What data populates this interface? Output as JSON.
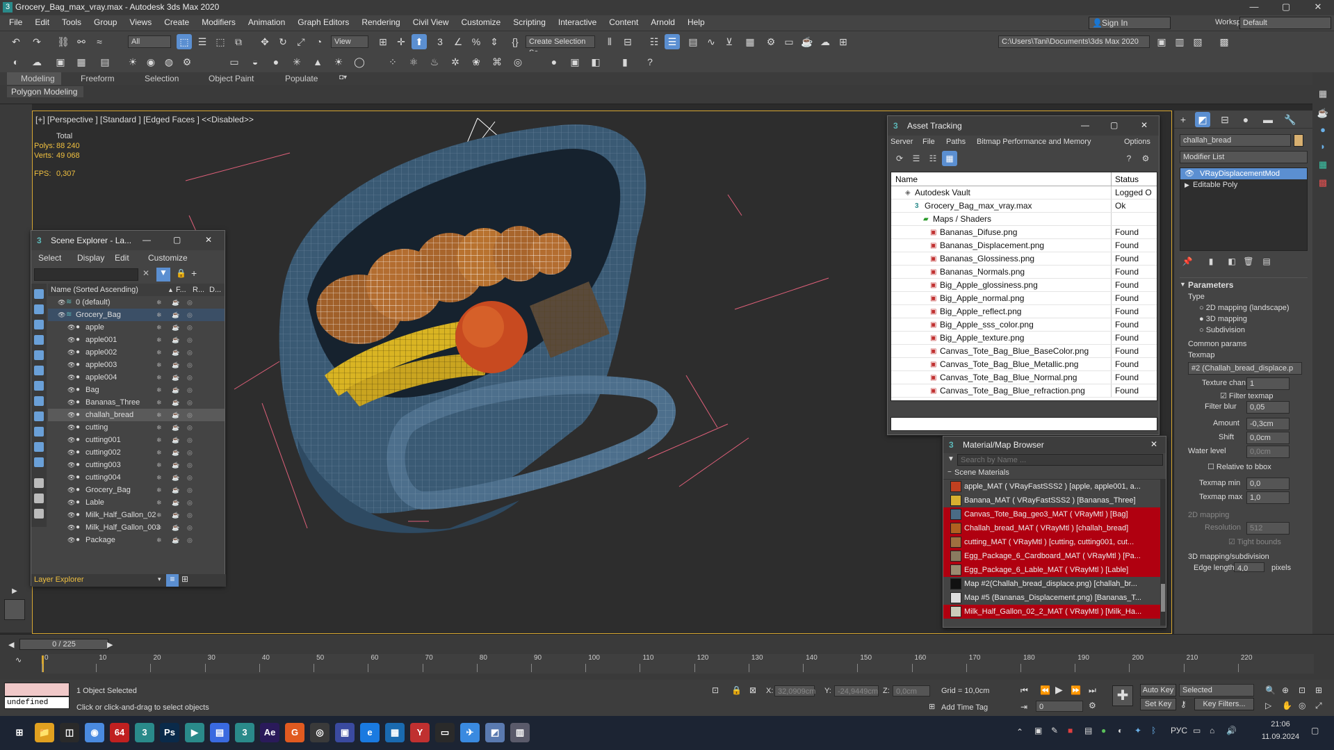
{
  "window": {
    "title": "Grocery_Bag_max_vray.max - Autodesk 3ds Max 2020",
    "app_icon": "3",
    "min": "—",
    "max": "▢",
    "close": "✕"
  },
  "menu": [
    "File",
    "Edit",
    "Tools",
    "Group",
    "Views",
    "Create",
    "Modifiers",
    "Animation",
    "Graph Editors",
    "Rendering",
    "Civil View",
    "Customize",
    "Scripting",
    "Interactive",
    "Content",
    "Arnold",
    "Help"
  ],
  "account": {
    "sign_in": "Sign In",
    "workspaces_label": "Workspaces:",
    "workspace": "Default"
  },
  "toolbar": {
    "filter": "All",
    "ref_coord": "View",
    "selection_set": "Create Selection Se",
    "project_path": "C:\\Users\\Tani\\Documents\\3ds Max 2020"
  },
  "ribbon": {
    "tabs": [
      "Modeling",
      "Freeform",
      "Selection",
      "Object Paint",
      "Populate"
    ],
    "sub": "Polygon Modeling"
  },
  "viewport": {
    "label": "[+] [Perspective ] [Standard ] [Edged Faces ]  <<Disabled>>",
    "stats_total": "Total",
    "polys_label": "Polys:",
    "polys": "88 240",
    "verts_label": "Verts:",
    "verts": "49 068",
    "fps_label": "FPS:",
    "fps": "0,307"
  },
  "scene_explorer": {
    "title": "Scene Explorer - La...",
    "menu": [
      "Select",
      "Display",
      "Edit",
      "Customize"
    ],
    "col_name": "Name (Sorted Ascending)",
    "col_f": "F...",
    "col_r": "R...",
    "col_d": "D...",
    "rows": [
      {
        "name": "0 (default)",
        "indent": 1
      },
      {
        "name": "Grocery_Bag",
        "indent": 1
      },
      {
        "name": "apple",
        "indent": 2
      },
      {
        "name": "apple001",
        "indent": 2
      },
      {
        "name": "apple002",
        "indent": 2
      },
      {
        "name": "apple003",
        "indent": 2
      },
      {
        "name": "apple004",
        "indent": 2
      },
      {
        "name": "Bag",
        "indent": 2
      },
      {
        "name": "Bananas_Three",
        "indent": 2
      },
      {
        "name": "challah_bread",
        "indent": 2
      },
      {
        "name": "cutting",
        "indent": 2
      },
      {
        "name": "cutting001",
        "indent": 2
      },
      {
        "name": "cutting002",
        "indent": 2
      },
      {
        "name": "cutting003",
        "indent": 2
      },
      {
        "name": "cutting004",
        "indent": 2
      },
      {
        "name": "Grocery_Bag",
        "indent": 2
      },
      {
        "name": "Lable",
        "indent": 2
      },
      {
        "name": "Milk_Half_Gallon_02",
        "indent": 2
      },
      {
        "name": "Milk_Half_Gallon_003",
        "indent": 2
      },
      {
        "name": "Package",
        "indent": 2
      }
    ],
    "footer": "Layer Explorer"
  },
  "asset_tracking": {
    "title": "Asset Tracking",
    "menu": [
      "Server",
      "File",
      "Paths",
      "Bitmap Performance and Memory",
      "Options"
    ],
    "col_name": "Name",
    "col_status": "Status",
    "rows": [
      {
        "name": "Autodesk Vault",
        "status": "Logged O"
      },
      {
        "name": "Grocery_Bag_max_vray.max",
        "status": "Ok"
      },
      {
        "name": "Maps / Shaders",
        "status": ""
      },
      {
        "name": "Bananas_Difuse.png",
        "status": "Found"
      },
      {
        "name": "Bananas_Displacement.png",
        "status": "Found"
      },
      {
        "name": "Bananas_Glossiness.png",
        "status": "Found"
      },
      {
        "name": "Bananas_Normals.png",
        "status": "Found"
      },
      {
        "name": "Big_Apple_glossiness.png",
        "status": "Found"
      },
      {
        "name": "Big_Apple_normal.png",
        "status": "Found"
      },
      {
        "name": "Big_Apple_reflect.png",
        "status": "Found"
      },
      {
        "name": "Big_Apple_sss_color.png",
        "status": "Found"
      },
      {
        "name": "Big_Apple_texture.png",
        "status": "Found"
      },
      {
        "name": "Canvas_Tote_Bag_Blue_BaseColor.png",
        "status": "Found"
      },
      {
        "name": "Canvas_Tote_Bag_Blue_Metallic.png",
        "status": "Found"
      },
      {
        "name": "Canvas_Tote_Bag_Blue_Normal.png",
        "status": "Found"
      },
      {
        "name": "Canvas_Tote_Bag_Blue_refraction.png",
        "status": "Found"
      }
    ]
  },
  "material_browser": {
    "title": "Material/Map Browser",
    "search_placeholder": "Search by Name ...",
    "group": "Scene Materials",
    "rows": [
      {
        "name": "apple_MAT  ( VRayFastSSS2 ) [apple, apple001, a...",
        "red": false,
        "color": "#c04020"
      },
      {
        "name": "Banana_MAT  ( VRayFastSSS2 ) [Bananas_Three]",
        "red": false,
        "color": "#d8b030"
      },
      {
        "name": "Canvas_Tote_Bag_geo3_MAT  ( VRayMtl ) [Bag]",
        "red": true,
        "color": "#4a6b85"
      },
      {
        "name": "Challah_bread_MAT  ( VRayMtl ) [challah_bread]",
        "red": true,
        "color": "#b06020"
      },
      {
        "name": "cutting_MAT  ( VRayMtl ) [cutting, cutting001, cut...",
        "red": true,
        "color": "#a07040"
      },
      {
        "name": "Egg_Package_6_Cardboard_MAT  ( VRayMtl ) [Pa...",
        "red": true,
        "color": "#8a7a60"
      },
      {
        "name": "Egg_Package_6_Lable_MAT  ( VRayMtl ) [Lable]",
        "red": true,
        "color": "#9a8a70"
      },
      {
        "name": "Map #2(Challah_bread_displace.png) [challah_br...",
        "red": false,
        "color": "#111111"
      },
      {
        "name": "Map #5 (Bananas_Displacement.png) [Bananas_T...",
        "red": false,
        "color": "#dddddd"
      },
      {
        "name": "Milk_Half_Gallon_02_2_MAT  ( VRayMtl ) [Milk_Ha...",
        "red": true,
        "color": "#ccccbb"
      }
    ]
  },
  "command_panel": {
    "object_name": "challah_bread",
    "modifier_list": "Modifier List",
    "stack": [
      "VRayDisplacementMod",
      "Editable Poly"
    ],
    "params_title": "Parameters",
    "type_label": "Type",
    "type_options": [
      "2D mapping (landscape)",
      "3D mapping",
      "Subdivision"
    ],
    "common_params": "Common params",
    "texmap_label": "Texmap",
    "texmap_value": "#2 (Challah_bread_displace.p",
    "texture_chan_label": "Texture chan",
    "texture_chan": "1",
    "filter_texmap": "Filter texmap",
    "filter_blur_label": "Filter blur",
    "filter_blur": "0,05",
    "amount_label": "Amount",
    "amount": "-0,3cm",
    "shift_label": "Shift",
    "shift": "0,0cm",
    "water_level_label": "Water level",
    "water_level": "0,0cm",
    "relative_bbox": "Relative to bbox",
    "texmap_min_label": "Texmap min",
    "texmap_min": "0,0",
    "texmap_max_label": "Texmap max",
    "texmap_max": "1,0",
    "mapping_2d": "2D mapping",
    "resolution_label": "Resolution",
    "resolution": "512",
    "tight_bounds": "Tight bounds",
    "mapping_3d": "3D mapping/subdivision",
    "edge_length_label": "Edge length",
    "edge_length": "4,0",
    "pixels": "pixels"
  },
  "timeline": {
    "frame": "0 / 225",
    "ticks": [
      "0",
      "10",
      "20",
      "30",
      "40",
      "50",
      "60",
      "70",
      "80",
      "90",
      "100",
      "110",
      "120",
      "130",
      "140",
      "150",
      "160",
      "170",
      "180",
      "190",
      "200",
      "210",
      "220"
    ]
  },
  "status": {
    "maxscript": "undefined",
    "selected": "1 Object Selected",
    "prompt": "Click or click-and-drag to select objects",
    "x_label": "X:",
    "x": "32,0909cm",
    "y_label": "Y:",
    "y": "-24,9449cm",
    "z_label": "Z:",
    "z": "0,0cm",
    "grid": "Grid = 10,0cm",
    "add_time_tag": "Add Time Tag",
    "auto_key": "Auto Key",
    "set_key": "Set Key",
    "selected_dd": "Selected",
    "key_filters": "Key Filters...",
    "frame_field": "0"
  },
  "taskbar": {
    "lang": "РУС",
    "time": "21:06",
    "date": "11.09.2024",
    "apps": [
      "⊞",
      "📁",
      "◫",
      "◉",
      "64",
      "3",
      "Ps",
      "▶",
      "▤",
      "3",
      "Ae",
      "G",
      "◎",
      "▣",
      "e",
      "▦",
      "Y",
      "▭",
      "✈",
      "◩",
      "▥"
    ]
  }
}
